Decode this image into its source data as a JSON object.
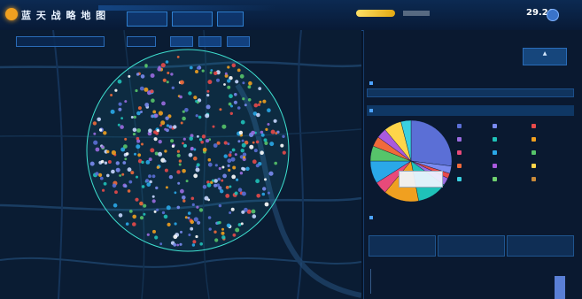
{
  "app": {
    "title": "蓝 天 战 略 地 图"
  },
  "topbar": {
    "tabs": [
      {
        "label": ""
      },
      {
        "label": ""
      },
      {
        "label": ""
      }
    ],
    "date": "",
    "time": "29.26",
    "user": ""
  },
  "map": {
    "toolbar": {
      "select1": "",
      "select2": "",
      "btn1": "",
      "btn2": "",
      "btn3": ""
    },
    "footer_label": ""
  },
  "panel": {
    "title": "",
    "subtitle": "",
    "action_button": "",
    "sections": {
      "s1": {
        "title": "",
        "text": ""
      },
      "s2": {
        "title": ""
      },
      "s3": {
        "title": "",
        "text": ""
      },
      "s4": {
        "title": ""
      }
    },
    "legend": [
      {
        "label": "",
        "color": "#5b6fd6"
      },
      {
        "label": "",
        "color": "#7a8bf0"
      },
      {
        "label": "",
        "color": "#e84a4a"
      },
      {
        "label": "",
        "color": "#9a6be0"
      },
      {
        "label": "",
        "color": "#1fc1b8"
      },
      {
        "label": "",
        "color": "#f0a020"
      },
      {
        "label": "",
        "color": "#e84a7a"
      },
      {
        "label": "",
        "color": "#2aa8e8"
      },
      {
        "label": "",
        "color": "#56c46a"
      },
      {
        "label": "",
        "color": "#f06a3a"
      },
      {
        "label": "",
        "color": "#aa5adf"
      },
      {
        "label": "",
        "color": "#ffd54a"
      },
      {
        "label": "",
        "color": "#3ad0e0"
      },
      {
        "label": "",
        "color": "#6fd06f"
      },
      {
        "label": "",
        "color": "#c98a3a"
      }
    ],
    "tooltip": {
      "line1": "",
      "line2": ""
    },
    "stats": [
      {
        "label": "",
        "value": ""
      },
      {
        "label": "",
        "value": ""
      },
      {
        "label": "",
        "value": ""
      }
    ],
    "chart_caption": ""
  },
  "pie": {
    "slices": [
      {
        "name": "",
        "value": 27,
        "color": "#5b6fd6"
      },
      {
        "name": "",
        "value": 3,
        "color": "#7a8bf0"
      },
      {
        "name": "",
        "value": 2,
        "color": "#e84a4a"
      },
      {
        "name": "",
        "value": 3,
        "color": "#9a6be0"
      },
      {
        "name": "",
        "value": 12,
        "color": "#1fc1b8"
      },
      {
        "name": "",
        "value": 14,
        "color": "#f0a020"
      },
      {
        "name": "",
        "value": 5,
        "color": "#e84a7a"
      },
      {
        "name": "",
        "value": 9,
        "color": "#2aa8e8"
      },
      {
        "name": "",
        "value": 6,
        "color": "#56c46a"
      },
      {
        "name": "",
        "value": 4,
        "color": "#f06a3a"
      },
      {
        "name": "",
        "value": 4,
        "color": "#aa5adf"
      },
      {
        "name": "",
        "value": 7,
        "color": "#ffd54a"
      },
      {
        "name": "",
        "value": 4,
        "color": "#3ad0e0"
      }
    ]
  }
}
